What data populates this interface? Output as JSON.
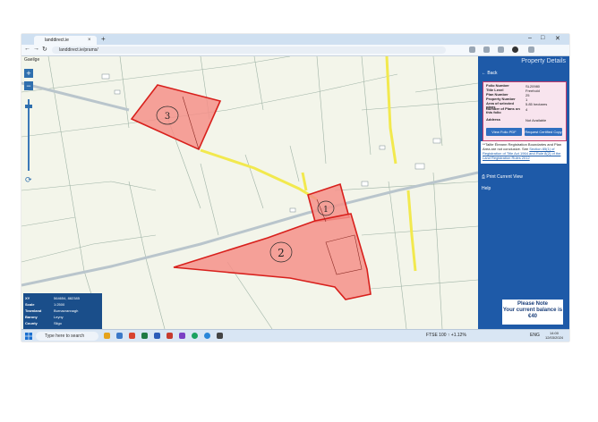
{
  "browser": {
    "tab_title": "landdirect.ie",
    "tab_close": "×",
    "new_tab": "+",
    "url": "landdirect.ie/prams/",
    "win_min": "–",
    "win_max": "□",
    "win_close": "✕",
    "nav_back": "←",
    "nav_forward": "→",
    "nav_reload": "↻"
  },
  "map": {
    "language_label": "Gaeilge",
    "zoom_in": "+",
    "zoom_out": "−",
    "parcel_labels": [
      "3",
      "1",
      "2"
    ],
    "info": {
      "rows": [
        {
          "key": "XY",
          "value": "564654, 882385"
        },
        {
          "key": "Scale",
          "value": "1:2500"
        },
        {
          "key": "Townland",
          "value": "Burnacrannagh"
        },
        {
          "key": "Barony",
          "value": "Leyny"
        },
        {
          "key": "County",
          "value": "Sligo"
        }
      ]
    }
  },
  "panel": {
    "header": "Property Details",
    "back_label": "Back",
    "details": [
      {
        "key": "Folio Number",
        "value": "SL20980"
      },
      {
        "key": "Title Level",
        "value": "Freehold"
      },
      {
        "key": "Plan Number",
        "value": "25"
      },
      {
        "key": "Property Number",
        "value": "1"
      },
      {
        "key": "Area of selected plans",
        "value": "5.85 hectares"
      },
      {
        "key": "Number of Plans on this folio",
        "value": "4"
      },
      {
        "key": "Address",
        "value": "Not Available"
      }
    ],
    "view_pdf_label": "View Folio PDF",
    "request_copy_label": "Request Certified Copy",
    "disclaimer_text": "**Tailte Éireann Registration Boundaries and Plan Area are not conclusive. See",
    "disclaimer_link": "Section 85(1) of Registration of Title Act 1964 and Rule 8(2) of the Land Registration Rules 2012",
    "print_label": "Print Current View",
    "help_label": "Help"
  },
  "note": {
    "title": "Please Note",
    "line1": "Your current balance is",
    "line2": "€40"
  },
  "taskbar": {
    "search_placeholder": "Type here to search",
    "ticker": "FTSE 100 ↑ +1.12%",
    "lang": "ENG",
    "time": "14:00",
    "date": "12/03/2024"
  },
  "colors": {
    "panel_blue": "#1e5aa8",
    "parcel_fill": "#f4918a",
    "parcel_stroke": "#d8201c",
    "road_yellow": "#f2e94e"
  }
}
